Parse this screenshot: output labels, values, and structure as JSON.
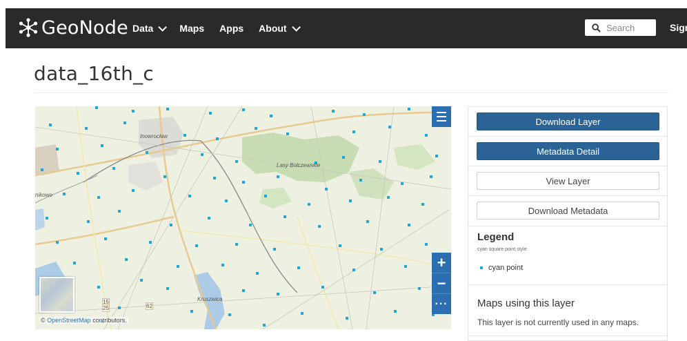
{
  "navbar": {
    "brand": "GeoNode",
    "items": [
      {
        "label": "Data",
        "dropdown": true
      },
      {
        "label": "Maps",
        "dropdown": false
      },
      {
        "label": "Apps",
        "dropdown": false
      },
      {
        "label": "About",
        "dropdown": true
      }
    ],
    "search_placeholder": "Search",
    "signin": "Sign in"
  },
  "page": {
    "title": "data_16th_c"
  },
  "map": {
    "labels": [
      "Inowrocław",
      "Lasy Bolczewskie",
      "nikowo",
      "Kruszwica",
      "15",
      "25",
      "62"
    ],
    "attribution_prefix": "© ",
    "attribution_link": "OpenStreetMap",
    "attribution_suffix": " contributors.",
    "zoom_in": "+",
    "zoom_out": "−",
    "more": "···"
  },
  "panel": {
    "download_layer": "Download Layer",
    "metadata_detail": "Metadata Detail",
    "view_layer": "View Layer",
    "download_metadata": "Download Metadata",
    "legend_title": "Legend",
    "legend_subtitle": "cyan square point style",
    "legend_item": "cyan point",
    "maps_title": "Maps using this layer",
    "maps_text": "This layer is not currently used in any maps."
  },
  "colors": {
    "navbar": "#2a2a2a",
    "primary_button": "#2c6396",
    "map_control": "#2c6fb0",
    "point": "#1fa7d6"
  }
}
